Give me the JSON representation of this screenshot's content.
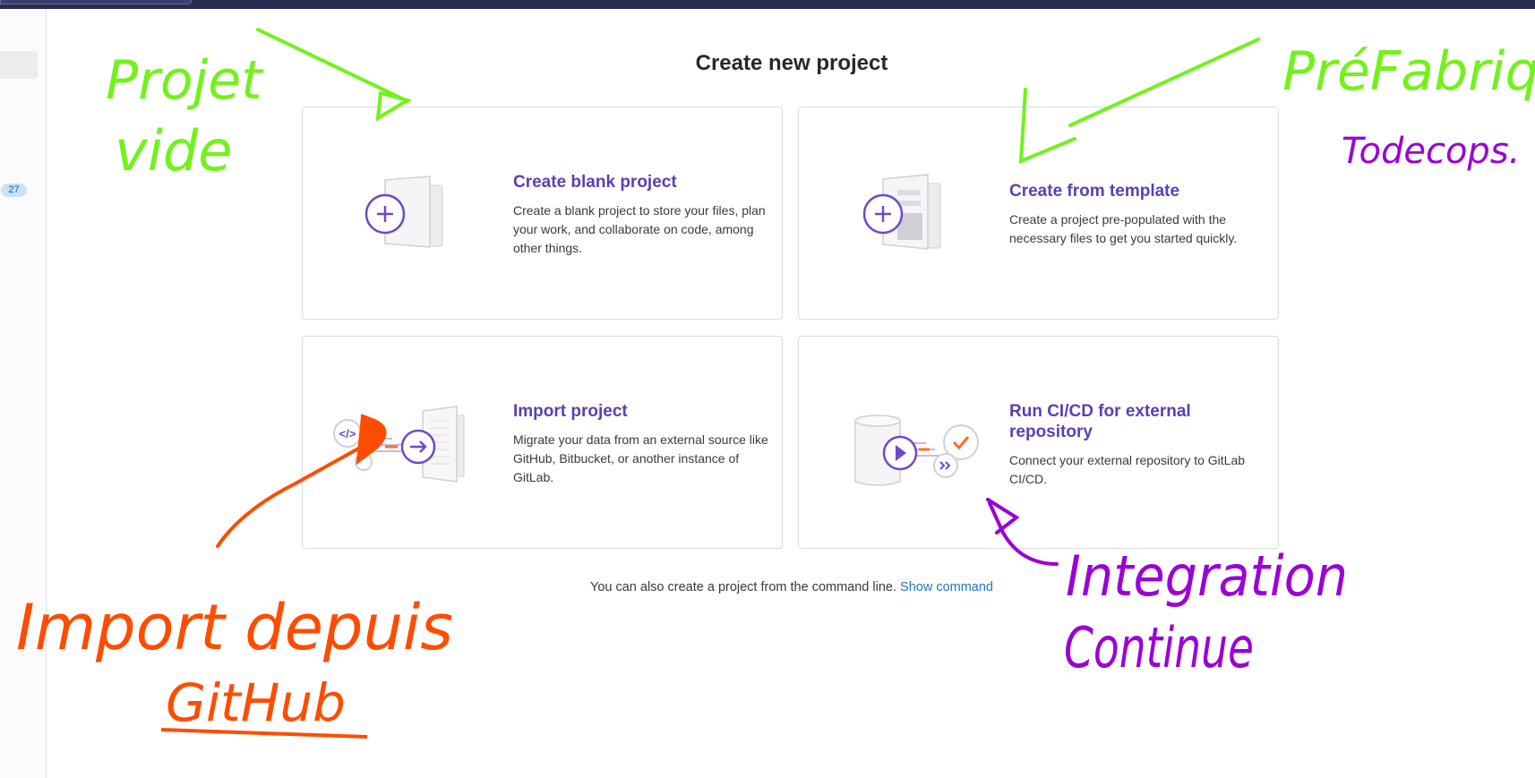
{
  "sidebar": {
    "badge_count": "27"
  },
  "page": {
    "title": "Create new project",
    "cards": [
      {
        "title": "Create blank project",
        "description": "Create a blank project to store your files, plan your work, and collaborate on code, among other things.",
        "icon": "blank-project-illustration"
      },
      {
        "title": "Create from template",
        "description": "Create a project pre-populated with the necessary files to get you started quickly.",
        "icon": "template-project-illustration"
      },
      {
        "title": "Import project",
        "description": "Migrate your data from an external source like GitHub, Bitbucket, or another instance of GitLab.",
        "icon": "import-project-illustration"
      },
      {
        "title": "Run CI/CD for external repository",
        "description": "Connect your external repository to GitLab CI/CD.",
        "icon": "cicd-project-illustration"
      }
    ],
    "footer_text": "You can also create a project from the command line.",
    "footer_link": "Show command"
  },
  "annotations": {
    "green_top_left_line1": "Projet",
    "green_top_left_line2": "vide",
    "green_top_right": "PréFabriqué",
    "purple_top_right": "Todecops.",
    "orange_bottom_left_line1": "Import depuis",
    "orange_bottom_left_line2": "GitHub",
    "purple_bottom_right_line1": "Integration",
    "purple_bottom_right_line2": "Continue"
  },
  "colors": {
    "accent_purple": "#5b3fb8",
    "link_blue": "#1f75cb",
    "annotation_green": "#72f21b",
    "annotation_purple": "#9b00d6",
    "annotation_orange": "#ff4c00"
  }
}
